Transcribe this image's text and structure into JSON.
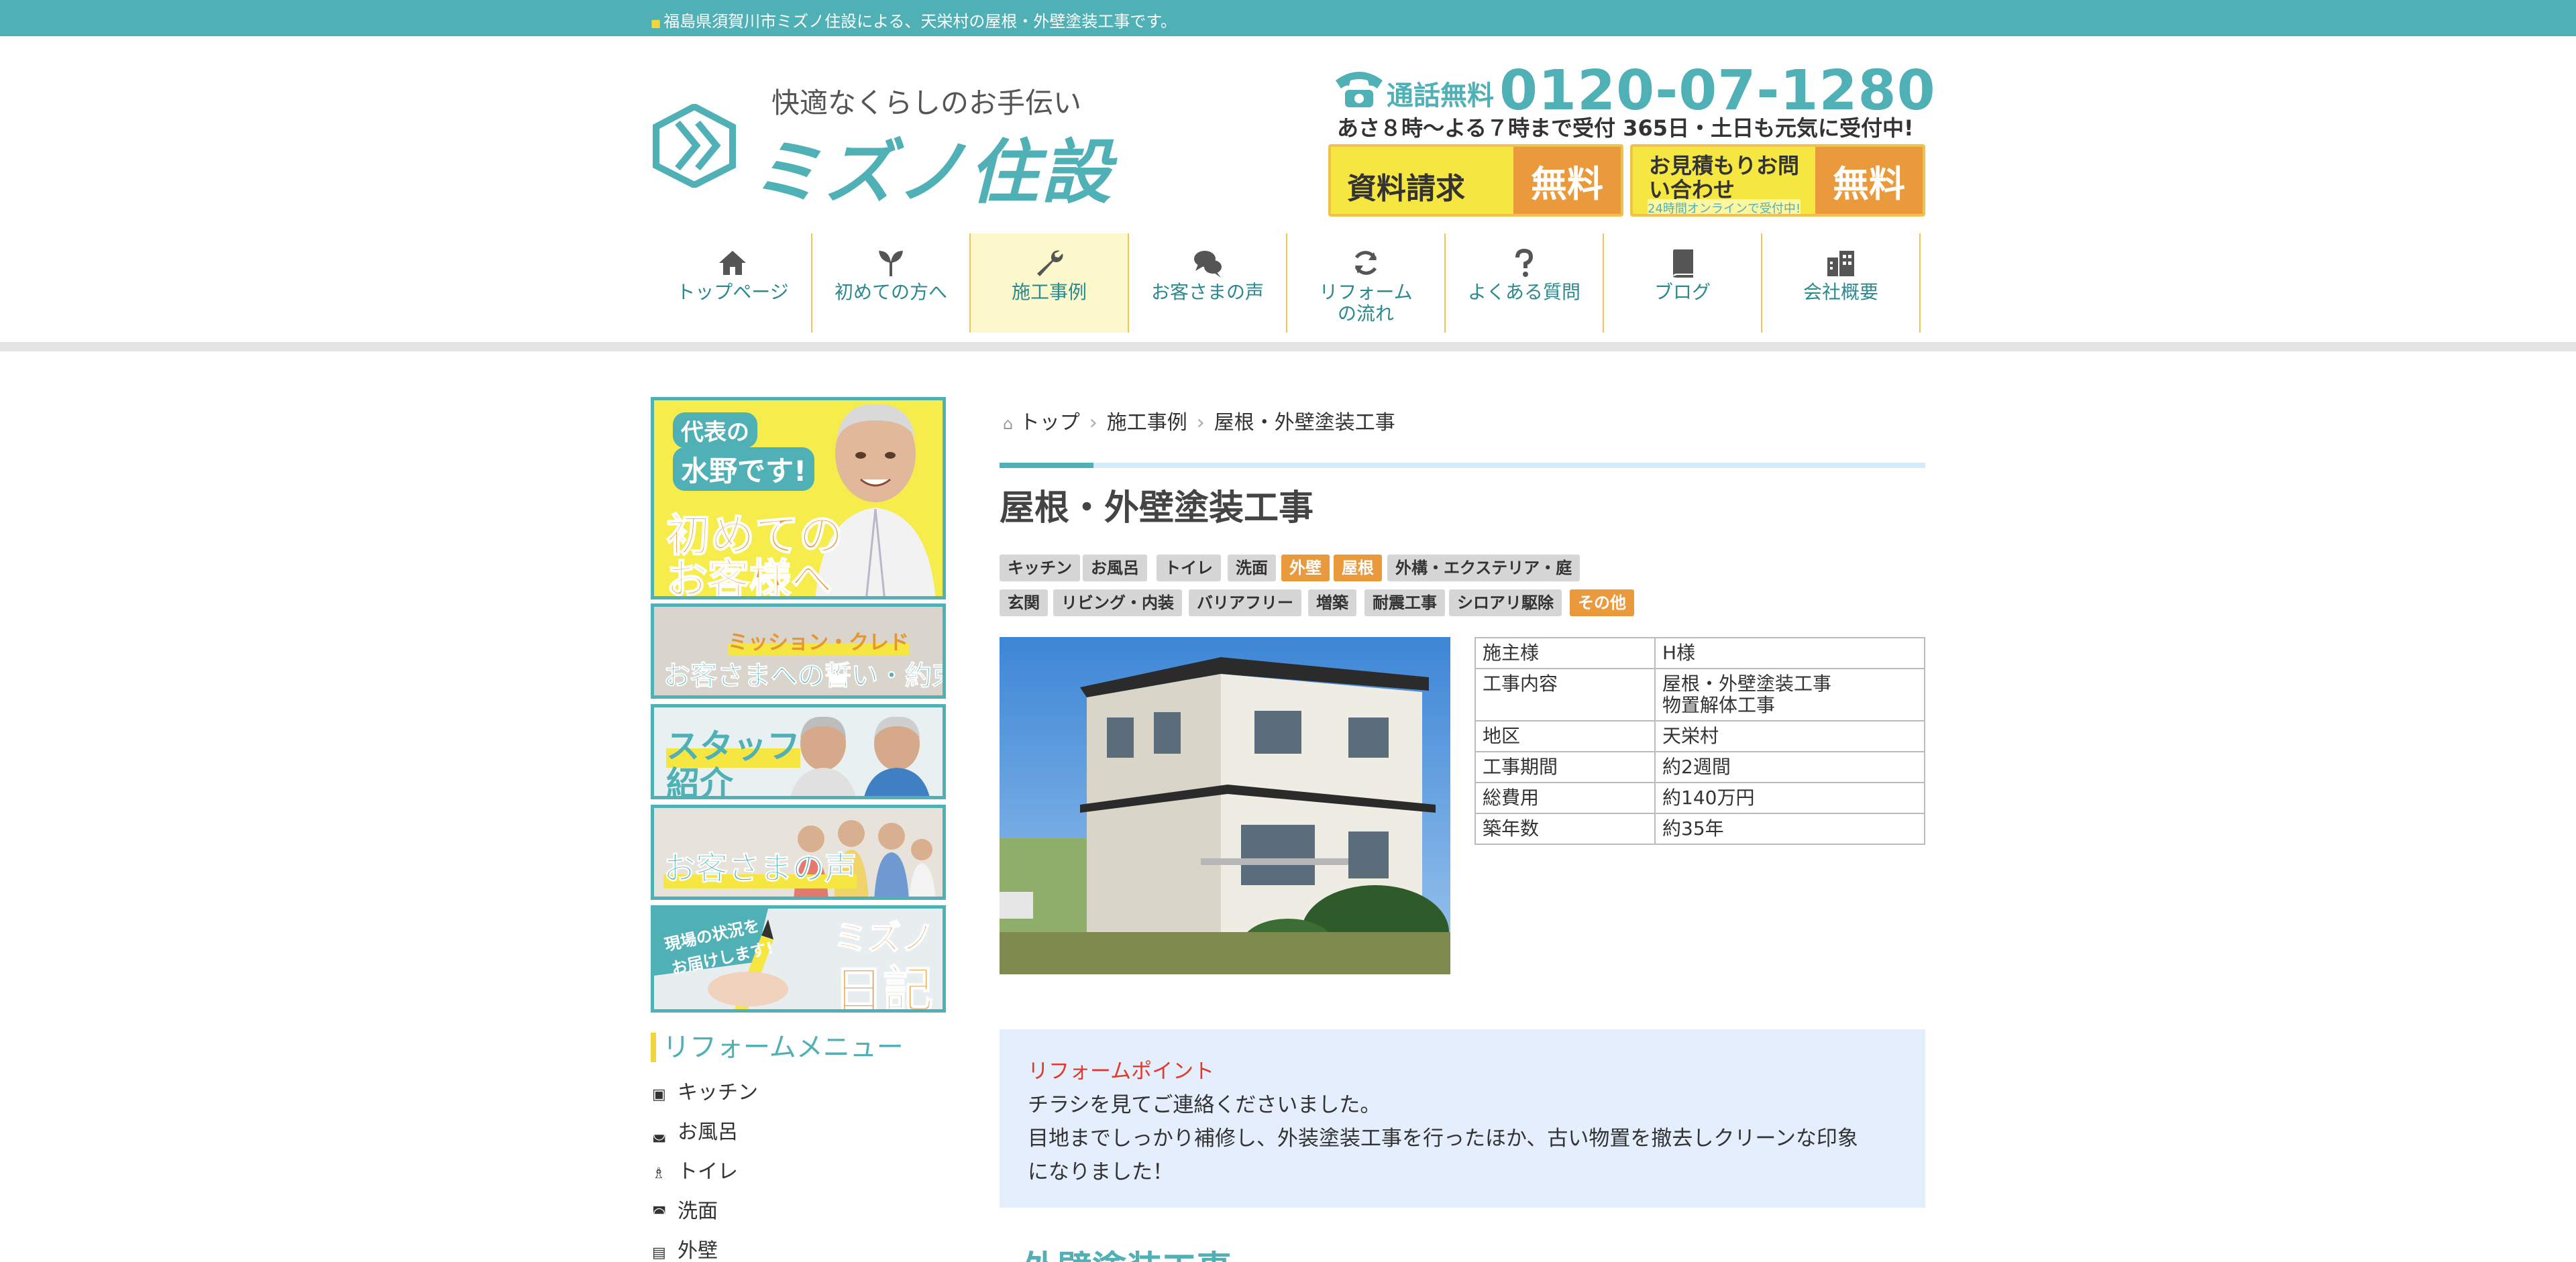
{
  "topbar": {
    "tagline": "福島県須賀川市ミズノ住設による、天栄村の屋根・外壁塗装工事です。"
  },
  "header": {
    "logo_sub": "快適なくらしのお手伝い",
    "logo_main": "ミズノ住設",
    "tel_label": "通話無料",
    "tel_number": "0120-07-1280",
    "tel_hours": "あさ８時〜よる７時まで受付 365日・土日も元気に受付中!",
    "cta_request": "資料請求",
    "cta_estimate": "お見積もりお問い合わせ",
    "cta_estimate_note": "24時間オンラインで受付中!",
    "cta_free": "無料"
  },
  "nav": [
    {
      "label": "トップページ",
      "icon": "home-icon"
    },
    {
      "label": "初めての方へ",
      "icon": "sprout-icon"
    },
    {
      "label": "施工事例",
      "icon": "wrench-icon"
    },
    {
      "label": "お客さまの声",
      "icon": "speech-bubbles-icon"
    },
    {
      "label": "リフォームの流れ",
      "icon": "refresh-icon"
    },
    {
      "label": "よくある質問",
      "icon": "question-icon"
    },
    {
      "label": "ブログ",
      "icon": "notebook-icon"
    },
    {
      "label": "会社概要",
      "icon": "building-icon"
    }
  ],
  "sidebar": {
    "banners": {
      "b1_line1": "代表の",
      "b1_line2": "水野です!",
      "b1_line3": "初めての",
      "b1_line4": "お客様へ",
      "b2_line1": "ミッション・クレド",
      "b2_line2": "お客さまへの誓い・約束",
      "b3_line1": "スタッフ",
      "b3_line2": "紹介",
      "b4_line1": "お客さまの声",
      "b5_line1": "現場の状況を",
      "b5_line2": "お届けします!",
      "b5_line3": "ミズノ",
      "b5_line4": "日記"
    },
    "menu_title": "リフォームメニュー",
    "menu_items": [
      "キッチン",
      "お風呂",
      "トイレ",
      "洗面",
      "外壁"
    ]
  },
  "main": {
    "breadcrumb": [
      "トップ",
      "施工事例",
      "屋根・外壁塗装工事"
    ],
    "title": "屋根・外壁塗装工事",
    "tags_row1": [
      "キッチン",
      "お風呂",
      "トイレ",
      "洗面",
      "外壁",
      "屋根",
      "外構・エクステリア・庭"
    ],
    "tags_row2": [
      "玄関",
      "リビング・内装",
      "バリアフリー",
      "増築",
      "耐震工事",
      "シロアリ駆除",
      "その他"
    ],
    "active_tags": [
      "外壁",
      "屋根",
      "その他"
    ],
    "spec": [
      {
        "k": "施主様",
        "v": "H様"
      },
      {
        "k": "工事内容",
        "v": "屋根・外壁塗装工事",
        "v2": "物置解体工事"
      },
      {
        "k": "地区",
        "v": "天栄村"
      },
      {
        "k": "工事期間",
        "v": "約2週間"
      },
      {
        "k": "総費用",
        "v": "約140万円"
      },
      {
        "k": "築年数",
        "v": "約35年"
      }
    ],
    "point_label": "リフォームポイント",
    "point_line1": "チラシを見てご連絡くださいました。",
    "point_line2": "目地までしっかり補修し、外装塗装工事を行ったほか、古い物置を撤去しクリーンな印象",
    "point_line3": "になりました！",
    "section_title": "外壁塗装工事"
  },
  "colors": {
    "teal": "#4fb0b5",
    "orange": "#ea9a3c",
    "yellow": "#f5e642",
    "point_bg": "#e4eefc"
  }
}
